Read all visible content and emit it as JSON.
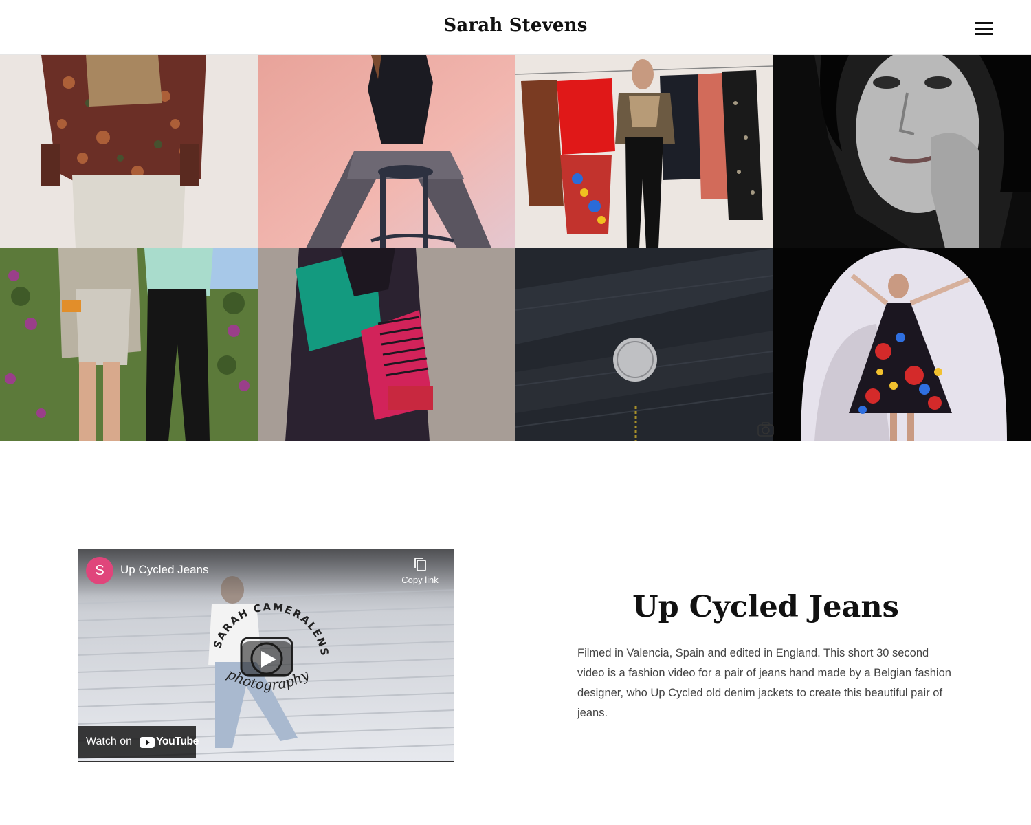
{
  "header": {
    "site_title": "Sarah Stevens"
  },
  "gallery": {
    "tiles": [
      {
        "name": "floral-blouse-vest-photo"
      },
      {
        "name": "sequin-trousers-stool-photo"
      },
      {
        "name": "clothesline-outfit-photo"
      },
      {
        "name": "black-white-portrait-photo"
      },
      {
        "name": "knitwear-garden-photo"
      },
      {
        "name": "colorblock-jacket-photo"
      },
      {
        "name": "denim-ck-button-photo"
      },
      {
        "name": "floral-dress-studio-photo"
      }
    ]
  },
  "video": {
    "channel_initial": "S",
    "title": "Up Cycled Jeans",
    "copy_link_label": "Copy link",
    "watch_on_label": "Watch on",
    "youtube_label": "YouTube",
    "watermark_top": "SARAH CAMERALENS",
    "watermark_bottom": "photography"
  },
  "article": {
    "heading": "Up Cycled Jeans",
    "body": "Filmed in Valencia, Spain and edited in England. This short 30 second video is a fashion video for a pair of jeans hand made by a Belgian fashion designer, who Up Cycled old denim jackets to create this beautiful pair of jeans."
  },
  "colors": {
    "avatar": "#e0457b",
    "title_text": "#111111",
    "body_text": "#444444"
  }
}
